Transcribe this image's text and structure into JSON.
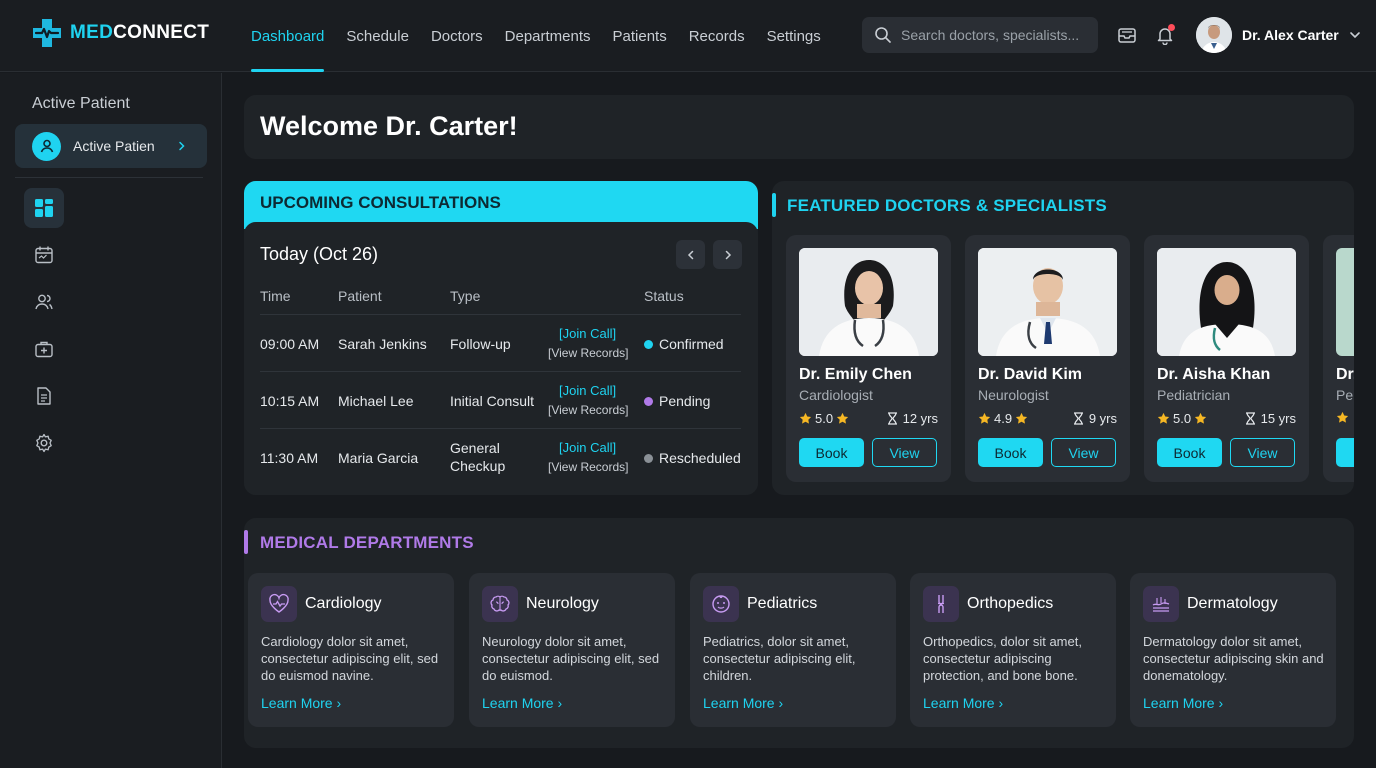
{
  "brand": {
    "part1": "MED",
    "part2": "CONNECT"
  },
  "nav": [
    {
      "label": "Dashboard"
    },
    {
      "label": "Schedule"
    },
    {
      "label": "Doctors"
    },
    {
      "label": "Departments"
    },
    {
      "label": "Patients"
    },
    {
      "label": "Records"
    },
    {
      "label": "Settings"
    }
  ],
  "search": {
    "placeholder": "Search doctors, specialists..."
  },
  "user": {
    "name": "Dr. Alex Carter"
  },
  "sidebar": {
    "title": "Active Patient",
    "pill_label": "Active Patient"
  },
  "welcome": {
    "title": "Welcome Dr. Carter!"
  },
  "consultations": {
    "title": "UPCOMING CONSULTATIONS",
    "day": "Today (Oct 26)",
    "headers": {
      "time": "Time",
      "patient": "Patient",
      "type": "Type",
      "status": "Status"
    },
    "join_label": "[Join Call]",
    "records_label": "[View Records]",
    "rows": [
      {
        "time": "09:00 AM",
        "patient": "Sarah Jenkins",
        "type": "Follow-up",
        "type2": "",
        "status": "Confirmed",
        "dot": "#1fd3f0"
      },
      {
        "time": "10:15 AM",
        "patient": "Michael Lee",
        "type": "Initial Consult",
        "type2": "",
        "status": "Pending",
        "dot": "#b07ae8"
      },
      {
        "time": "11:30 AM",
        "patient": "Maria Garcia",
        "type": "General",
        "type2": "Checkup",
        "status": "Rescheduled",
        "dot": "#8a9096"
      }
    ]
  },
  "featured": {
    "title": "FEATURED DOCTORS & SPECIALISTS",
    "book_label": "Book",
    "view_label": "View",
    "doctors": [
      {
        "name": "Dr. Emily Chen",
        "specialty": "Cardiologist",
        "rating": "5.0",
        "years": "12 yrs"
      },
      {
        "name": "Dr. David Kim",
        "specialty": "Neurologist",
        "rating": "4.9",
        "years": "9 yrs"
      },
      {
        "name": "Dr. Aisha Khan",
        "specialty": "Pediatrician",
        "rating": "5.0",
        "years": "15 yrs"
      },
      {
        "name": "Dr.",
        "specialty": "Per",
        "rating": "",
        "years": ""
      }
    ]
  },
  "departments": {
    "title": "MEDICAL DEPARTMENTS",
    "more_label": "Learn More",
    "items": [
      {
        "name": "Cardiology",
        "desc": "Cardiology dolor sit amet, consectetur adipiscing elit, sed do euismod navine."
      },
      {
        "name": "Neurology",
        "desc": "Neurology dolor sit amet, consectetur adipiscing elit, sed do euismod."
      },
      {
        "name": "Pediatrics",
        "desc": "Pediatrics, dolor sit amet, consectetur adipiscing elit, children."
      },
      {
        "name": "Orthopedics",
        "desc": "Orthopedics, dolor sit amet, consectetur adipiscing protection, and bone bone."
      },
      {
        "name": "Dermatology",
        "desc": "Dermatology dolor sit amet, consectetur adipiscing skin and donematology."
      }
    ]
  },
  "colors": {
    "accent": "#1fd3f0",
    "purple": "#b07ae8",
    "background": "#171a1e",
    "panel": "#1f2327",
    "card": "#2a2e34"
  }
}
